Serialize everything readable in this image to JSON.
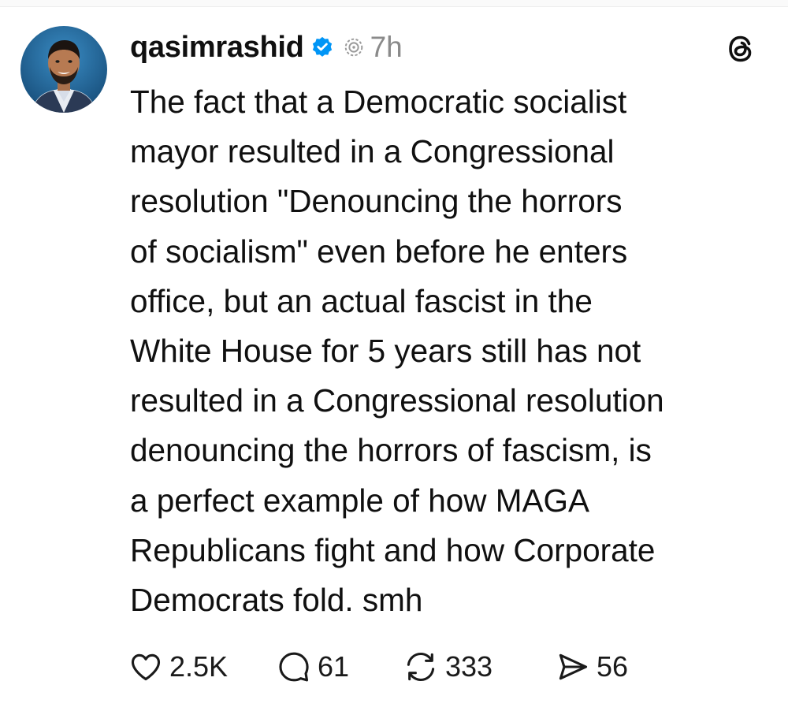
{
  "post": {
    "author": {
      "username": "qasimrashid",
      "verified": true,
      "avatar": "avatar-photo"
    },
    "time": "7h",
    "body_lines": [
      "The fact that a Democratic socialist",
      "mayor resulted in a Congressional",
      "resolution \"Denouncing the horrors",
      "of socialism\" even before he enters",
      "office, but an actual fascist in the",
      "White House for 5 years still has not",
      "resulted in a Congressional resolution",
      "denouncing the horrors of fascism, is",
      "a perfect example of how MAGA",
      "Republicans fight and how Corporate",
      "Democrats fold. smh"
    ],
    "actions": {
      "likes": "2.5K",
      "replies": "61",
      "reposts": "333",
      "shares": "56"
    }
  },
  "icons": {
    "verified": "verified-badge-icon",
    "repost_state": "repost-indicator-icon",
    "logo": "threads-logo-icon",
    "like": "heart-icon",
    "reply": "speech-bubble-icon",
    "repost": "repost-arrows-icon",
    "share": "send-icon"
  },
  "colors": {
    "text": "#101010",
    "secondary": "#8a8a8a",
    "verified": "#0095f6",
    "avatar_bg": "#1f5e8c"
  }
}
